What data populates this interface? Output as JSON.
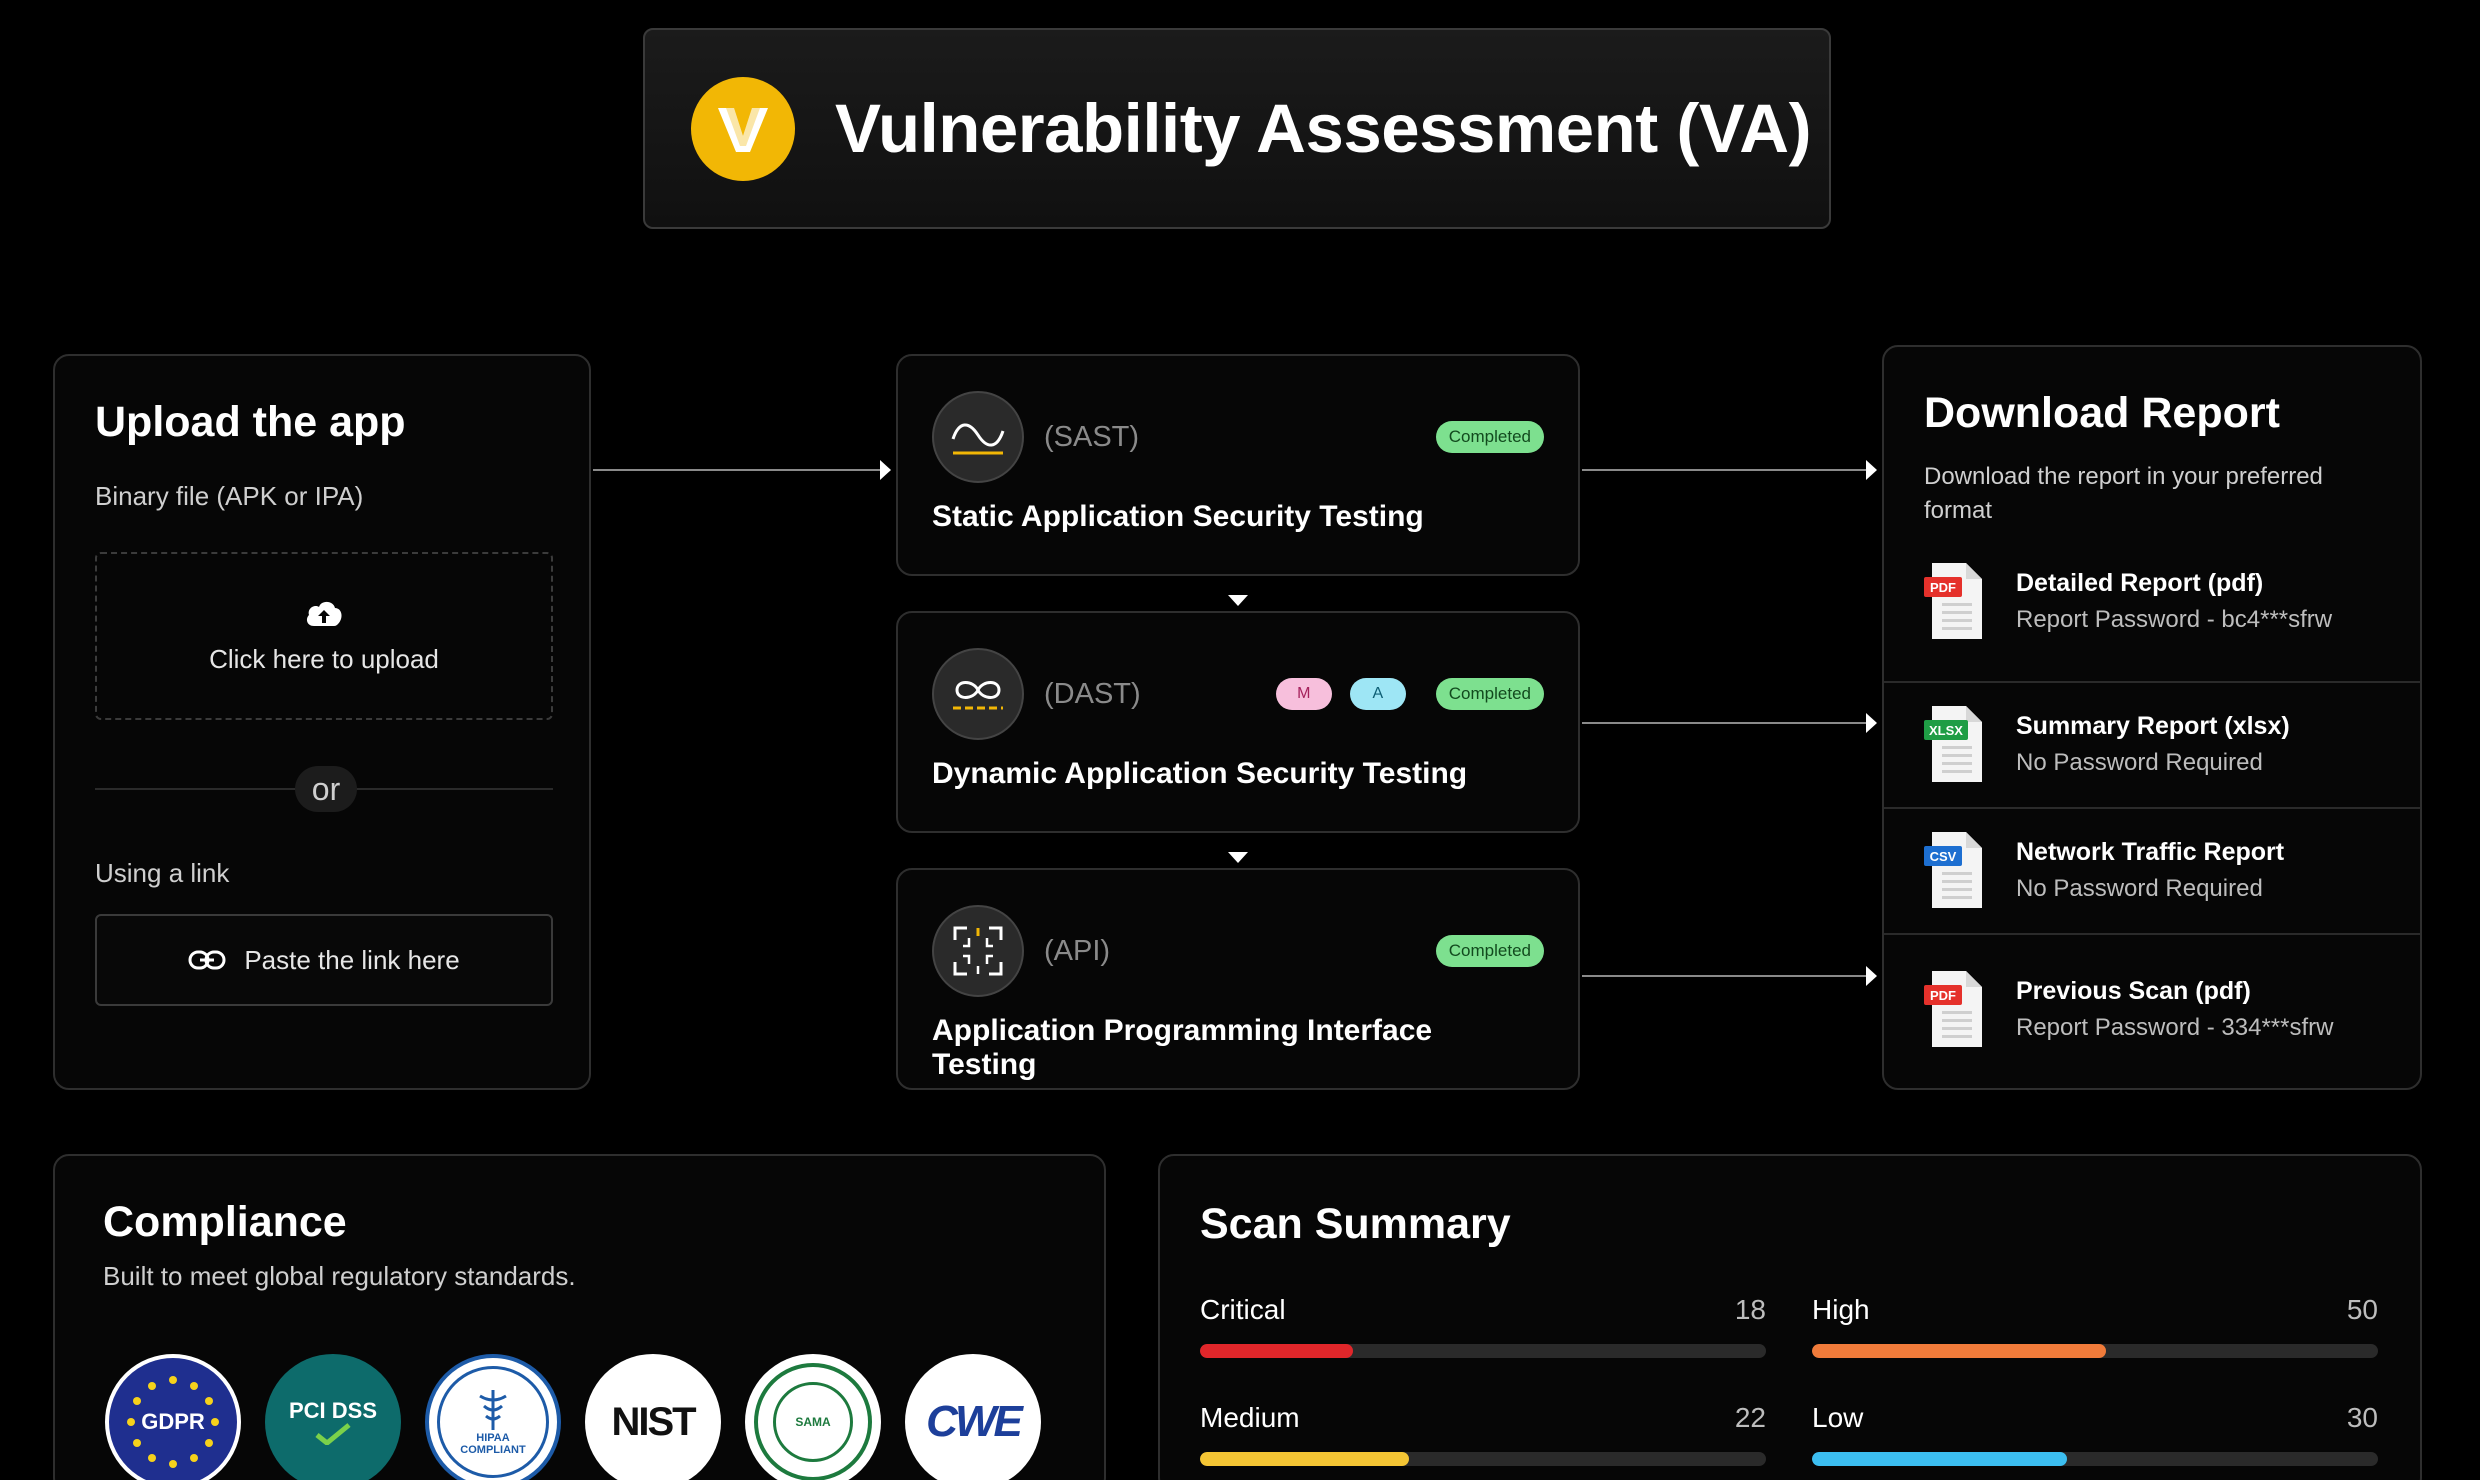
{
  "header": {
    "title": "Vulnerability Assessment (VA)",
    "logo_letter": "V",
    "logo_color": "#f2b705"
  },
  "upload": {
    "title": "Upload the app",
    "binary_label": "Binary file (APK or IPA)",
    "upload_text": "Click here to upload",
    "or_text": "or",
    "link_label": "Using a link",
    "link_button": "Paste the link here"
  },
  "tests": [
    {
      "tag": "(SAST)",
      "status": "Completed",
      "name": "Static Application Security Testing",
      "icon": "wave-icon"
    },
    {
      "tag": "(DAST)",
      "status": "Completed",
      "name": "Dynamic Application Security Testing",
      "icon": "infinity-icon",
      "chips": [
        "M",
        "A"
      ]
    },
    {
      "tag": "(API)",
      "status": "Completed",
      "name": "Application Programming Interface Testing",
      "icon": "scan-frame-icon"
    }
  ],
  "download": {
    "title": "Download Report",
    "subtitle": "Download the report in your preferred format",
    "reports": [
      {
        "name": "Detailed Report (pdf)",
        "sub": "Report Password - bc4***sfrw",
        "type": "PDF",
        "type_color": "#e5312b"
      },
      {
        "name": "Summary Report (xlsx)",
        "sub": "No Password Required",
        "type": "XLSX",
        "type_color": "#1f9d45"
      },
      {
        "name": "Network Traffic Report",
        "sub": "No Password Required",
        "type": "CSV",
        "type_color": "#1d6fd1"
      },
      {
        "name": "Previous Scan (pdf)",
        "sub": "Report Password - 334***sfrw",
        "type": "PDF",
        "type_color": "#e5312b"
      }
    ]
  },
  "compliance": {
    "title": "Compliance",
    "subtitle": "Built to meet global regulatory standards.",
    "logos": [
      "GDPR",
      "PCI DSS",
      "HIPAA COMPLIANT",
      "NIST",
      "SAMA",
      "CWE"
    ]
  },
  "scan_summary": {
    "title": "Scan Summary",
    "metrics": [
      {
        "label": "Critical",
        "value": "18",
        "fraction": 0.27,
        "color": "#e0262a"
      },
      {
        "label": "High",
        "value": "50",
        "fraction": 0.52,
        "color": "#f07b3a"
      },
      {
        "label": "Medium",
        "value": "22",
        "fraction": 0.37,
        "color": "#f4c534"
      },
      {
        "label": "Low",
        "value": "30",
        "fraction": 0.45,
        "color": "#3cbef0"
      }
    ]
  }
}
